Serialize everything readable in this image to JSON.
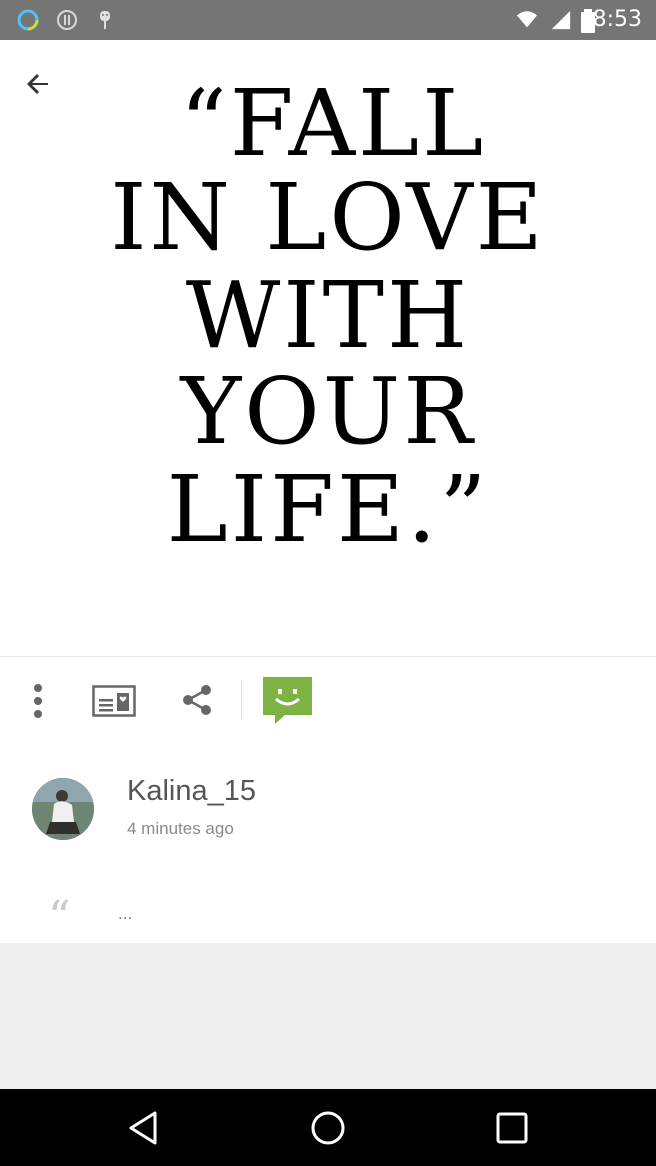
{
  "status_bar": {
    "time": "8:53"
  },
  "quote": {
    "lines": [
      "“FALL",
      "IN LOVE",
      "WITH",
      "YOUR",
      "LIFE.”"
    ]
  },
  "actions": {
    "more": "more-vert-icon",
    "save": "card-heart-icon",
    "share": "share-icon",
    "comment": "smiley-chat-icon",
    "comment_color": "#7cb342"
  },
  "post": {
    "username": "Kalina_15",
    "timestamp": "4 minutes ago",
    "comment_text": "..."
  },
  "colors": {
    "status_bar": "#757575",
    "nav_bar": "#000000",
    "grey_area": "#efefef"
  }
}
